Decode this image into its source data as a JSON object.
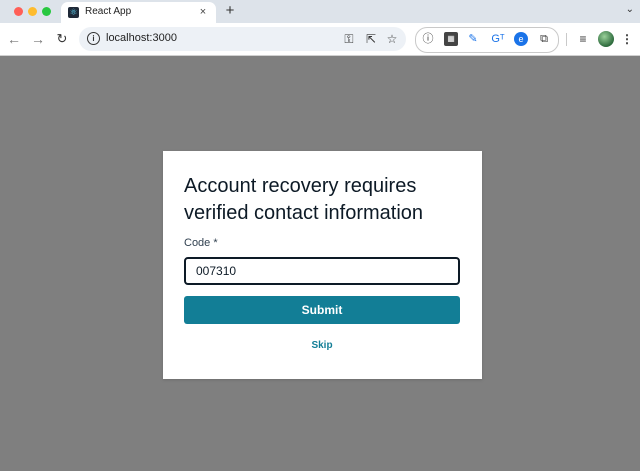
{
  "browser": {
    "tab_title": "React App",
    "tab_close": "×",
    "new_tab": "+",
    "tab_menu": "⌄",
    "url": "localhost:3000",
    "nav": {
      "back": "←",
      "forward": "→",
      "reload": "↻"
    },
    "omnibox_icons": {
      "info": "i",
      "key": "⚿",
      "share": "⇱",
      "star": "☆"
    },
    "extensions": [
      "ⓘ",
      "▦",
      "✎",
      "Gᵀ",
      "e",
      "⧉"
    ],
    "toolbar_right": {
      "media": "≡",
      "menu": "⋮"
    }
  },
  "dialog": {
    "heading": "Account recovery requires verified contact information",
    "code_label": "Code *",
    "code_value": "007310",
    "submit_label": "Submit",
    "skip_label": "Skip"
  },
  "colors": {
    "accent": "#127e96",
    "backdrop": "#7f7f7f"
  }
}
